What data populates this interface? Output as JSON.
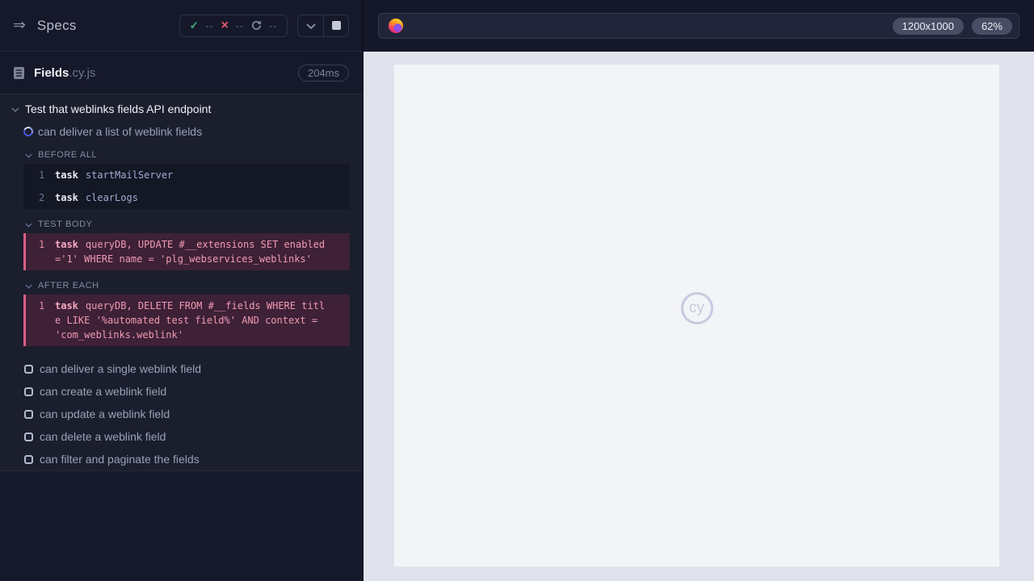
{
  "reporter": {
    "header": {
      "title": "Specs",
      "menu_icon_glyph": "⇒",
      "stats": {
        "passed_icon": "✓",
        "passed": "--",
        "failed_icon": "×",
        "failed": "--",
        "pending": "--"
      }
    },
    "spec": {
      "name": "Fields",
      "ext": ".cy.js",
      "duration": "204ms"
    },
    "suite": {
      "title": "Test that weblinks fields API endpoint"
    },
    "active_test": {
      "title": "can deliver a list of weblink fields"
    },
    "hooks": [
      {
        "label": "BEFORE ALL",
        "commands": [
          {
            "num": "1",
            "method": "task",
            "message": "startMailServer"
          },
          {
            "num": "2",
            "method": "task",
            "message": "clearLogs"
          }
        ]
      },
      {
        "label": "TEST BODY",
        "commands": [
          {
            "num": "1",
            "method": "task",
            "message": "queryDB, UPDATE #__extensions SET enabled='1' WHERE name = 'plg_webservices_weblinks'"
          }
        ]
      },
      {
        "label": "AFTER EACH",
        "commands": [
          {
            "num": "1",
            "method": "task",
            "message": "queryDB, DELETE FROM #__fields WHERE title LIKE '%automated test field%' AND context = 'com_weblinks.weblink'"
          }
        ]
      }
    ],
    "pending_tests": [
      "can deliver a single weblink field",
      "can create a weblink field",
      "can update a weblink field",
      "can delete a weblink field",
      "can filter and paginate the fields"
    ]
  },
  "browser": {
    "viewport_size": "1200x1000",
    "zoom": "62%",
    "watermark": "cy"
  },
  "colors": {
    "pass_green": "#3bb87f",
    "fail_red": "#e8566d",
    "highlight_pink": "#d95f82",
    "reporter_bg": "#1b1e2d",
    "viewport_bg": "#e1e3ec"
  }
}
